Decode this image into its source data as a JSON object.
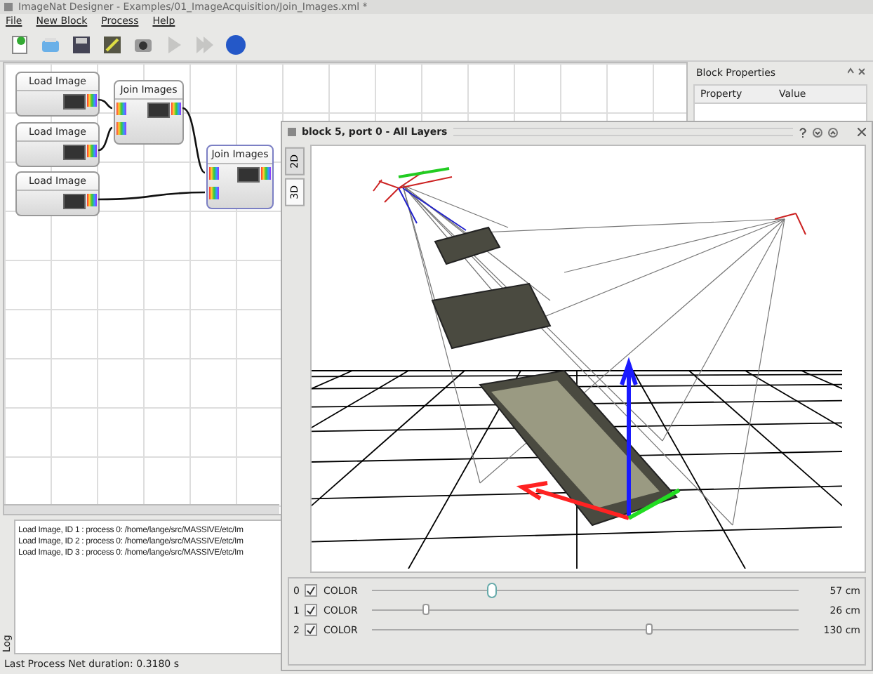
{
  "window": {
    "title": "ImageNat Designer - Examples/01_ImageAcquisition/Join_Images.xml *"
  },
  "menu": [
    "File",
    "New Block",
    "Process",
    "Help"
  ],
  "toolbar": [
    {
      "kind": "new",
      "disabled": false
    },
    {
      "kind": "open",
      "disabled": false
    },
    {
      "kind": "save",
      "disabled": false
    },
    {
      "kind": "export",
      "disabled": false
    },
    {
      "kind": "capture",
      "disabled": false
    },
    {
      "kind": "run",
      "disabled": true
    },
    {
      "kind": "runall",
      "disabled": true
    },
    {
      "kind": "help",
      "disabled": false
    }
  ],
  "graph": {
    "nodes": [
      {
        "title": "Load Image",
        "kind": "source",
        "selected": false
      },
      {
        "title": "Load Image",
        "kind": "source",
        "selected": false
      },
      {
        "title": "Load Image",
        "kind": "source",
        "selected": false
      },
      {
        "title": "Join Images",
        "kind": "join",
        "selected": false
      },
      {
        "title": "Join Images",
        "kind": "join",
        "selected": true
      }
    ]
  },
  "block_properties": {
    "title": "Block Properties",
    "columns": [
      "Property",
      "Value"
    ]
  },
  "viewer": {
    "title": "block 5, port 0 - All Layers",
    "tabs": [
      {
        "label": "2D",
        "selected": false
      },
      {
        "label": "3D",
        "selected": true
      }
    ],
    "layers": [
      {
        "index": "0",
        "checked": true,
        "name": "COLOR",
        "level": 0.28,
        "reading": "57 cm"
      },
      {
        "index": "1",
        "checked": true,
        "name": "COLOR",
        "level": 0.13,
        "reading": "26 cm"
      },
      {
        "index": "2",
        "checked": true,
        "name": "COLOR",
        "level": 0.65,
        "reading": "130 cm"
      }
    ]
  },
  "log": {
    "title": "Log",
    "lines": [
      "Load Image, ID 1 : process 0: /home/lange/src/MASSIVE/etc/Im",
      "Load Image, ID 2 : process 0: /home/lange/src/MASSIVE/etc/Im",
      "Load Image, ID 3 : process 0: /home/lange/src/MASSIVE/etc/Im"
    ]
  },
  "status_bar": "Last Process Net duration: 0.3180 s"
}
